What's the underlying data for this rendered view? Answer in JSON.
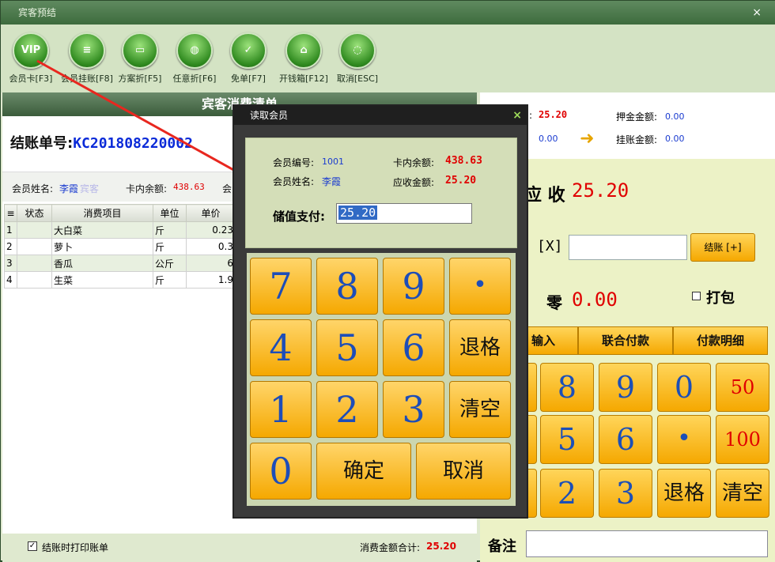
{
  "window": {
    "title": "宾客预结",
    "close": "×"
  },
  "toolbar": {
    "items": [
      {
        "label": "会员卡[F3]",
        "icon": "vip-icon",
        "glyph": "VIP"
      },
      {
        "label": "会员挂账[F8]",
        "icon": "member-credit-icon",
        "glyph": "≡"
      },
      {
        "label": "方案折[F5]",
        "icon": "plan-discount-icon",
        "glyph": "▭"
      },
      {
        "label": "任意折[F6]",
        "icon": "custom-discount-icon",
        "glyph": "◍"
      },
      {
        "label": "免单[F7]",
        "icon": "free-order-icon",
        "glyph": "✓"
      },
      {
        "label": "开钱箱[F12]",
        "icon": "cash-drawer-icon",
        "glyph": "⌂"
      },
      {
        "label": "取消[ESC]",
        "icon": "cancel-icon",
        "glyph": "◌"
      }
    ]
  },
  "left": {
    "header": "宾客消费清单",
    "bill_label": "结账单号:",
    "bill_no": "KC201808220002",
    "member_name_label": "会员姓名:",
    "member_name": "李霞",
    "member_suffix": "宾客",
    "balance_label": "卡内余额:",
    "balance": "438.63",
    "more_label": "会",
    "columns": [
      "状态",
      "消费项目",
      "单位",
      "单价"
    ],
    "rows": [
      {
        "no": "1",
        "status": "",
        "item": "大白菜",
        "unit": "斤",
        "price": "0.23"
      },
      {
        "no": "2",
        "status": "",
        "item": "萝卜",
        "unit": "斤",
        "price": "0.3"
      },
      {
        "no": "3",
        "status": "",
        "item": "香瓜",
        "unit": "公斤",
        "price": "6"
      },
      {
        "no": "4",
        "status": "",
        "item": "生菜",
        "unit": "斤",
        "price": "1.9"
      }
    ],
    "print_label": "结账时打印账单",
    "total_label": "消费金额合计:",
    "total": "25.20"
  },
  "right": {
    "top": {
      "a_label": ":",
      "a_value": "25.20",
      "deposit_label": "押金金额:",
      "deposit_value": "0.00",
      "b_value": "0.00",
      "credit_label": "挂账金额:",
      "credit_value": "0.00"
    },
    "receivable_label": "应 收",
    "receivable_value": "25.20",
    "x_label": "[X]",
    "settle_button": "结账 [+]",
    "change_label": "零",
    "change_value": "0.00",
    "pack_label": "打包",
    "tabs": [
      "输入",
      "联合付款",
      "付款明细"
    ],
    "keys": [
      [
        "",
        "8",
        "9",
        "0",
        "50"
      ],
      [
        "",
        "5",
        "6",
        "•",
        "100"
      ],
      [
        "",
        "2",
        "3",
        "退格",
        "清空"
      ]
    ],
    "remark_label": "备注"
  },
  "dialog": {
    "title": "读取会员",
    "member_no_label": "会员编号:",
    "member_no": "1001",
    "card_balance_label": "卡内余额:",
    "card_balance": "438.63",
    "member_name_label": "会员姓名:",
    "member_name": "李霞",
    "receivable_label": "应收金额:",
    "receivable": "25.20",
    "stored_pay_label": "储值支付:",
    "stored_pay": "25.20",
    "keys": {
      "k7": "7",
      "k8": "8",
      "k9": "9",
      "kdot": "•",
      "k4": "4",
      "k5": "5",
      "k6": "6",
      "kback": "退格",
      "k1": "1",
      "k2": "2",
      "k3": "3",
      "kclear": "清空",
      "k0": "0",
      "confirm": "确定",
      "cancel": "取消"
    }
  },
  "colors": {
    "accent_red": "#e00000",
    "value_blue": "#1a3bd0",
    "key_orange": "#f5a800",
    "dark_green": "#3d6b3d"
  }
}
